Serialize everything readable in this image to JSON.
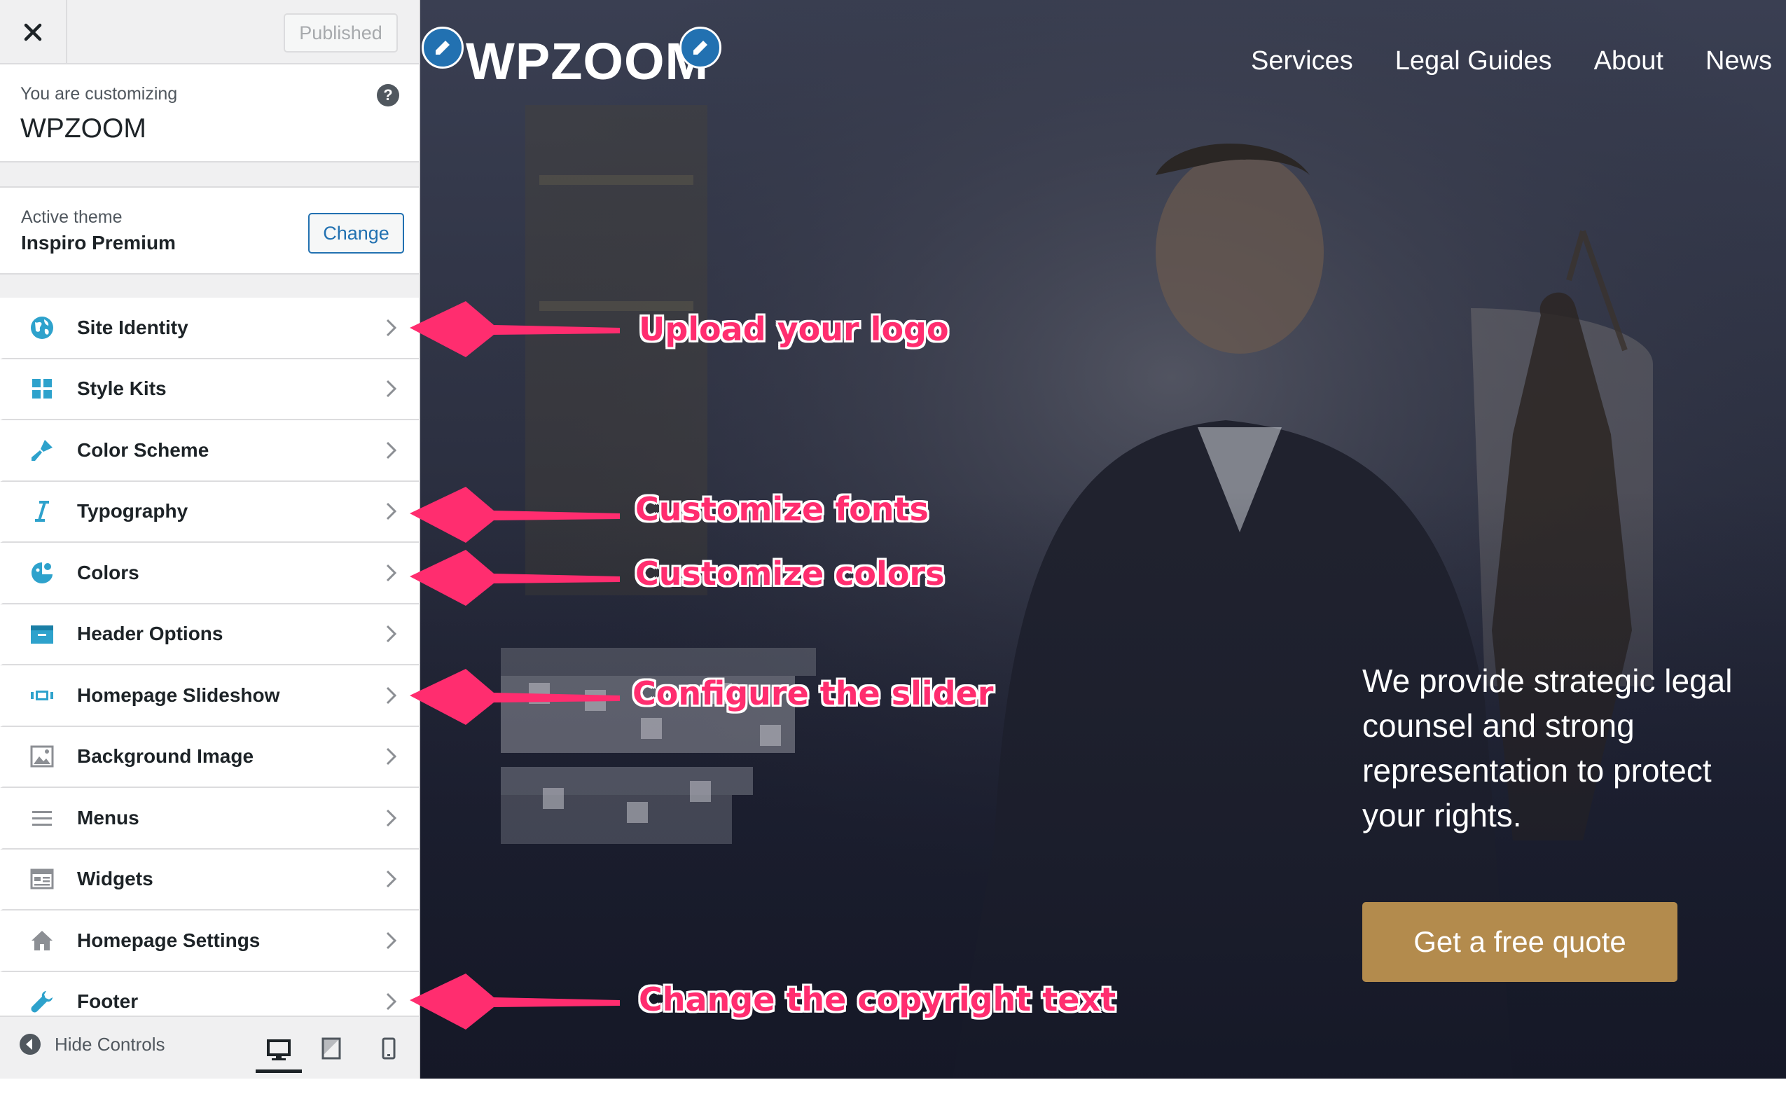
{
  "sidebar": {
    "close_icon": "close-icon",
    "published_label": "Published",
    "customizing_label": "You are customizing",
    "site_name": "WPZOOM",
    "help_icon": "?",
    "active_theme_label": "Active theme",
    "active_theme_name": "Inspiro Premium",
    "change_label": "Change",
    "items": [
      {
        "label": "Site Identity",
        "icon": "globe-icon"
      },
      {
        "label": "Style Kits",
        "icon": "grid-icon"
      },
      {
        "label": "Color Scheme",
        "icon": "paint-brush-icon"
      },
      {
        "label": "Typography",
        "icon": "italic-icon"
      },
      {
        "label": "Colors",
        "icon": "palette-icon"
      },
      {
        "label": "Header Options",
        "icon": "header-icon"
      },
      {
        "label": "Homepage Slideshow",
        "icon": "slideshow-icon"
      },
      {
        "label": "Background Image",
        "icon": "image-icon"
      },
      {
        "label": "Menus",
        "icon": "menu-icon"
      },
      {
        "label": "Widgets",
        "icon": "widgets-icon"
      },
      {
        "label": "Homepage Settings",
        "icon": "home-icon"
      },
      {
        "label": "Footer",
        "icon": "wrench-icon"
      }
    ],
    "footer": {
      "hide_controls_label": "Hide Controls",
      "devices": [
        "desktop-icon",
        "tablet-icon",
        "mobile-icon"
      ],
      "active_device": "desktop"
    }
  },
  "preview": {
    "logo": "WPZOOM",
    "nav": [
      "Services",
      "Legal Guides",
      "About",
      "News"
    ],
    "hero_text": "We provide strategic legal counsel and strong representation to protect your rights.",
    "cta_label": "Get a free quote"
  },
  "annotations": [
    {
      "text": "Upload your logo"
    },
    {
      "text": "Customize fonts"
    },
    {
      "text": "Customize colors"
    },
    {
      "text": "Configure the slider"
    },
    {
      "text": "Change the copyright text"
    }
  ],
  "colors": {
    "accent": "#2271b1",
    "icon": "#2ea2cc",
    "cta": "#b38b4d",
    "annotation": "#ff2d6f"
  }
}
